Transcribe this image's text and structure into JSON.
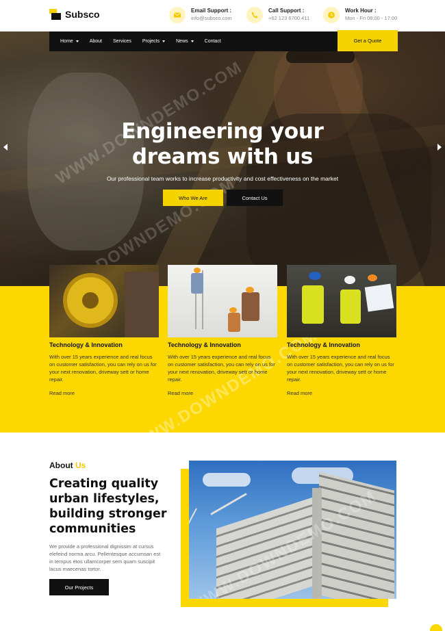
{
  "brand": {
    "name": "Subsco"
  },
  "header": {
    "contacts": [
      {
        "title": "Email Support :",
        "value": "info@subsco.com",
        "icon": "mail-icon"
      },
      {
        "title": "Call Support :",
        "value": "+62 123 6700 411",
        "icon": "phone-icon"
      },
      {
        "title": "Work Hour :",
        "value": "Mon - Fri 08:00 - 17:00",
        "icon": "clock-icon"
      }
    ]
  },
  "nav": {
    "items": [
      {
        "label": "Home",
        "dropdown": true
      },
      {
        "label": "About",
        "dropdown": false
      },
      {
        "label": "Services",
        "dropdown": false
      },
      {
        "label": "Projects",
        "dropdown": true
      },
      {
        "label": "News",
        "dropdown": true
      },
      {
        "label": "Contact",
        "dropdown": false
      }
    ],
    "cta": "Get a Quote"
  },
  "hero": {
    "title_line1": "Engineering your",
    "title_line2": "dreams with us",
    "subtitle": "Our professional team works to increase productivity and cost effectiveness on the market",
    "primary_button": "Who We Are",
    "secondary_button": "Contact Us"
  },
  "services": [
    {
      "title": "Technology & Innovation",
      "text": "With over 15 years experience and real focus on customer satisfaction, you can rely on us for your next renovation, driveway sett or home repair.",
      "link": "Read more"
    },
    {
      "title": "Technology & Innovation",
      "text": "With over 15 years experience and real focus on customer satisfaction, you can rely on us for your next renovation, driveway sett or home repair.",
      "link": "Read more"
    },
    {
      "title": "Technology & Innovation",
      "text": "With over 15 years experience and real focus on customer satisfaction, you can rely on us for your next renovation, driveway sett or home repair.",
      "link": "Read more"
    }
  ],
  "about": {
    "label": "About",
    "label_highlight": "Us",
    "title": "Creating quality urban lifestyles, building stronger communities",
    "text": "We provide a professional dignissim at cursus elefeind norma arcu. Pellentesque accumsan est in tempus etos ullamcorper sem quam suscipit lacus maecenas tortor.",
    "button": "Our Projects"
  },
  "colors": {
    "accent": "#fcd800",
    "dark": "#111111"
  }
}
